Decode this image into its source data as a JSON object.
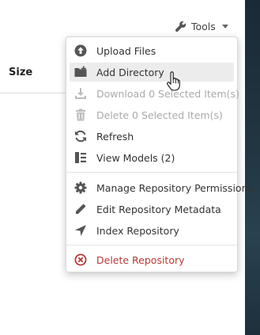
{
  "toolbar": {
    "tools_label": "Tools",
    "tools_icon": "wrench-icon"
  },
  "table": {
    "size_header": "Size"
  },
  "menu": {
    "items": [
      {
        "label": "Upload Files",
        "icon": "upload-circle-icon",
        "state": "normal"
      },
      {
        "label": "Add Directory",
        "icon": "folder-plus-icon",
        "state": "hover"
      },
      {
        "label": "Download 0 Selected Item(s)",
        "icon": "download-icon",
        "state": "disabled"
      },
      {
        "label": "Delete 0 Selected Item(s)",
        "icon": "trash-icon",
        "state": "disabled"
      },
      {
        "label": "Refresh",
        "icon": "refresh-icon",
        "state": "normal"
      },
      {
        "label": "View Models (2)",
        "icon": "models-icon",
        "state": "normal"
      },
      {
        "label": "Manage Repository Permissions",
        "icon": "gear-icon",
        "state": "normal"
      },
      {
        "label": "Edit Repository Metadata",
        "icon": "pencil-icon",
        "state": "normal"
      },
      {
        "label": "Index Repository",
        "icon": "location-arrow-icon",
        "state": "normal"
      },
      {
        "label": "Delete Repository",
        "icon": "delete-circle-icon",
        "state": "danger"
      }
    ]
  },
  "colors": {
    "danger": "#b03a3a",
    "disabled": "#aaaaaa",
    "hover_bg": "#ececec",
    "background_dark": "#223642"
  }
}
